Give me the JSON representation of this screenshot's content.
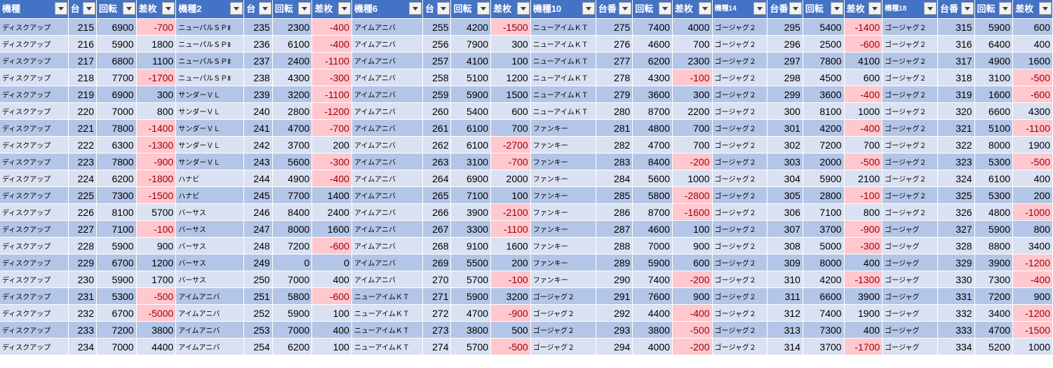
{
  "headers": [
    "機種",
    "台",
    "回転",
    "差枚",
    "機種2",
    "台",
    "回転",
    "差枚",
    "機種6",
    "台",
    "回転",
    "差枚",
    "機種10",
    "台番",
    "回転",
    "差枚",
    "機種14",
    "台番",
    "回転",
    "差枚",
    "機種18",
    "台番",
    "回転",
    "差枚"
  ],
  "rows": [
    [
      "ディスクアップ",
      "215",
      "6900",
      "-700",
      "ニューパルＳＰⅡ",
      "235",
      "2300",
      "-400",
      "アイムアニバ",
      "255",
      "4200",
      "-1500",
      "ニューアイムＫＴ",
      "275",
      "7400",
      "4000",
      "ゴージャグ２",
      "295",
      "5400",
      "-1400",
      "ゴージャグ２",
      "315",
      "5900",
      "600"
    ],
    [
      "ディスクアップ",
      "216",
      "5900",
      "1800",
      "ニューパルＳＰⅡ",
      "236",
      "6100",
      "-400",
      "アイムアニバ",
      "256",
      "7900",
      "300",
      "ニューアイムＫＴ",
      "276",
      "4600",
      "700",
      "ゴージャグ２",
      "296",
      "2500",
      "-600",
      "ゴージャグ２",
      "316",
      "6400",
      "400"
    ],
    [
      "ディスクアップ",
      "217",
      "6800",
      "1100",
      "ニューパルＳＰⅡ",
      "237",
      "2400",
      "-1100",
      "アイムアニバ",
      "257",
      "4100",
      "100",
      "ニューアイムＫＴ",
      "277",
      "6200",
      "2300",
      "ゴージャグ２",
      "297",
      "7800",
      "4100",
      "ゴージャグ２",
      "317",
      "4900",
      "1600"
    ],
    [
      "ディスクアップ",
      "218",
      "7700",
      "-1700",
      "ニューパルＳＰⅡ",
      "238",
      "4300",
      "-300",
      "アイムアニバ",
      "258",
      "5100",
      "1200",
      "ニューアイムＫＴ",
      "278",
      "4300",
      "-100",
      "ゴージャグ２",
      "298",
      "4500",
      "600",
      "ゴージャグ２",
      "318",
      "3100",
      "-500"
    ],
    [
      "ディスクアップ",
      "219",
      "6900",
      "300",
      "サンダーＶＬ",
      "239",
      "3200",
      "-1100",
      "アイムアニバ",
      "259",
      "5900",
      "1500",
      "ニューアイムＫＴ",
      "279",
      "3600",
      "300",
      "ゴージャグ２",
      "299",
      "3600",
      "-400",
      "ゴージャグ２",
      "319",
      "1600",
      "-600"
    ],
    [
      "ディスクアップ",
      "220",
      "7000",
      "800",
      "サンダーＶＬ",
      "240",
      "2800",
      "-1200",
      "アイムアニバ",
      "260",
      "5400",
      "600",
      "ニューアイムＫＴ",
      "280",
      "8700",
      "2200",
      "ゴージャグ２",
      "300",
      "8100",
      "1000",
      "ゴージャグ２",
      "320",
      "6600",
      "4300"
    ],
    [
      "ディスクアップ",
      "221",
      "7800",
      "-1400",
      "サンダーＶＬ",
      "241",
      "4700",
      "-700",
      "アイムアニバ",
      "261",
      "6100",
      "700",
      "ファンキー",
      "281",
      "4800",
      "700",
      "ゴージャグ２",
      "301",
      "4200",
      "-400",
      "ゴージャグ２",
      "321",
      "5100",
      "-1100"
    ],
    [
      "ディスクアップ",
      "222",
      "6300",
      "-1300",
      "サンダーＶＬ",
      "242",
      "3700",
      "200",
      "アイムアニバ",
      "262",
      "6100",
      "-2700",
      "ファンキー",
      "282",
      "4700",
      "700",
      "ゴージャグ２",
      "302",
      "7200",
      "700",
      "ゴージャグ２",
      "322",
      "8000",
      "1900"
    ],
    [
      "ディスクアップ",
      "223",
      "7800",
      "-900",
      "サンダーＶＬ",
      "243",
      "5600",
      "-300",
      "アイムアニバ",
      "263",
      "3100",
      "-700",
      "ファンキー",
      "283",
      "8400",
      "-200",
      "ゴージャグ２",
      "303",
      "2000",
      "-500",
      "ゴージャグ２",
      "323",
      "5300",
      "-500"
    ],
    [
      "ディスクアップ",
      "224",
      "6200",
      "-1800",
      "ハナビ",
      "244",
      "4900",
      "-400",
      "アイムアニバ",
      "264",
      "6900",
      "2000",
      "ファンキー",
      "284",
      "5600",
      "1000",
      "ゴージャグ２",
      "304",
      "5900",
      "2100",
      "ゴージャグ２",
      "324",
      "6100",
      "400"
    ],
    [
      "ディスクアップ",
      "225",
      "7300",
      "-1500",
      "ハナビ",
      "245",
      "7700",
      "1400",
      "アイムアニバ",
      "265",
      "7100",
      "100",
      "ファンキー",
      "285",
      "5800",
      "-2800",
      "ゴージャグ２",
      "305",
      "2800",
      "-100",
      "ゴージャグ２",
      "325",
      "5300",
      "200"
    ],
    [
      "ディスクアップ",
      "226",
      "8100",
      "5700",
      "バーサス",
      "246",
      "8400",
      "2400",
      "アイムアニバ",
      "266",
      "3900",
      "-2100",
      "ファンキー",
      "286",
      "8700",
      "-1600",
      "ゴージャグ２",
      "306",
      "7100",
      "800",
      "ゴージャグ２",
      "326",
      "4800",
      "-1000"
    ],
    [
      "ディスクアップ",
      "227",
      "7100",
      "-100",
      "バーサス",
      "247",
      "8000",
      "1600",
      "アイムアニバ",
      "267",
      "3300",
      "-1100",
      "ファンキー",
      "287",
      "4600",
      "100",
      "ゴージャグ２",
      "307",
      "3700",
      "-900",
      "ゴージャグ",
      "327",
      "5900",
      "800"
    ],
    [
      "ディスクアップ",
      "228",
      "5900",
      "900",
      "バーサス",
      "248",
      "7200",
      "-600",
      "アイムアニバ",
      "268",
      "9100",
      "1600",
      "ファンキー",
      "288",
      "7000",
      "900",
      "ゴージャグ２",
      "308",
      "5000",
      "-300",
      "ゴージャグ",
      "328",
      "8800",
      "3400"
    ],
    [
      "ディスクアップ",
      "229",
      "6700",
      "1200",
      "バーサス",
      "249",
      "0",
      "0",
      "アイムアニバ",
      "269",
      "5500",
      "200",
      "ファンキー",
      "289",
      "5900",
      "600",
      "ゴージャグ２",
      "309",
      "8000",
      "400",
      "ゴージャグ",
      "329",
      "3900",
      "-1200"
    ],
    [
      "ディスクアップ",
      "230",
      "5900",
      "1700",
      "バーサス",
      "250",
      "7000",
      "400",
      "アイムアニバ",
      "270",
      "5700",
      "-100",
      "ファンキー",
      "290",
      "7400",
      "-200",
      "ゴージャグ２",
      "310",
      "4200",
      "-1300",
      "ゴージャグ",
      "330",
      "7300",
      "-400"
    ],
    [
      "ディスクアップ",
      "231",
      "5300",
      "-500",
      "アイムアニバ",
      "251",
      "5800",
      "-600",
      "ニューアイムＫＴ",
      "271",
      "5900",
      "3200",
      "ゴージャグ２",
      "291",
      "7600",
      "900",
      "ゴージャグ２",
      "311",
      "6600",
      "3900",
      "ゴージャグ",
      "331",
      "7200",
      "900"
    ],
    [
      "ディスクアップ",
      "232",
      "6700",
      "-5000",
      "アイムアニバ",
      "252",
      "5900",
      "100",
      "ニューアイムＫＴ",
      "272",
      "4700",
      "-900",
      "ゴージャグ２",
      "292",
      "4400",
      "-400",
      "ゴージャグ２",
      "312",
      "7400",
      "1900",
      "ゴージャグ",
      "332",
      "3400",
      "-1200"
    ],
    [
      "ディスクアップ",
      "233",
      "7200",
      "3800",
      "アイムアニバ",
      "253",
      "7000",
      "400",
      "ニューアイムＫＴ",
      "273",
      "3800",
      "500",
      "ゴージャグ２",
      "293",
      "3800",
      "-500",
      "ゴージャグ２",
      "313",
      "7300",
      "400",
      "ゴージャグ",
      "333",
      "4700",
      "-1500"
    ],
    [
      "ディスクアップ",
      "234",
      "7000",
      "4400",
      "アイムアニバ",
      "254",
      "6200",
      "100",
      "ニューアイムＫＴ",
      "274",
      "5700",
      "-500",
      "ゴージャグ２",
      "294",
      "4000",
      "-200",
      "ゴージャグ２",
      "314",
      "3700",
      "-1700",
      "ゴージャグ",
      "334",
      "5200",
      "1000"
    ]
  ],
  "colors": {
    "header_bg": "#4472c4",
    "row_odd": "#b4c6e7",
    "row_even": "#d9e1f2",
    "negative_bg": "#ffc7ce",
    "negative_text": "#9c0006"
  }
}
